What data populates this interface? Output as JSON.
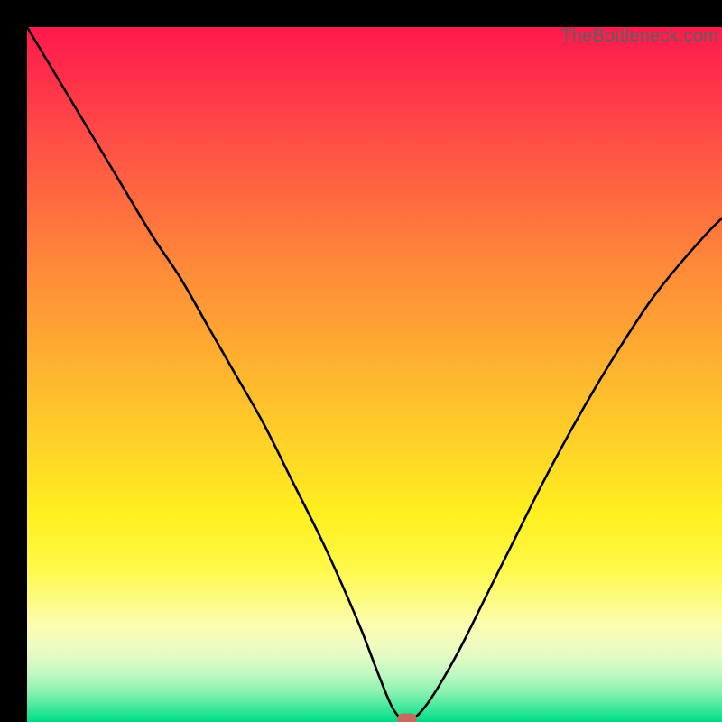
{
  "watermark": "TheBottleneck.com",
  "chart_data": {
    "type": "line",
    "title": "",
    "xlabel": "",
    "ylabel": "",
    "xlim": [
      0,
      100
    ],
    "ylim": [
      0,
      100
    ],
    "grid": false,
    "series": [
      {
        "name": "bottleneck-curve",
        "x": [
          0,
          6,
          12,
          18,
          22,
          26,
          30,
          34,
          38,
          42,
          45,
          48,
          50.5,
          52.5,
          54,
          55.5,
          58,
          62,
          66,
          70,
          74,
          78,
          82,
          86,
          90,
          94,
          98,
          100
        ],
        "y": [
          100,
          90,
          80,
          70,
          64,
          57,
          50,
          43,
          35,
          27,
          20.5,
          13.5,
          7,
          2.2,
          0.4,
          0.4,
          3.2,
          10,
          18,
          26,
          34,
          41.5,
          48.5,
          55,
          61,
          66,
          70.5,
          72.5
        ]
      }
    ],
    "optimum_marker": {
      "x": 54.7,
      "y": 0.4
    },
    "colors": {
      "curve": "#000000",
      "marker": "#c86a60",
      "gradient_top": "#ff1a4d",
      "gradient_bottom": "#00db83"
    }
  }
}
